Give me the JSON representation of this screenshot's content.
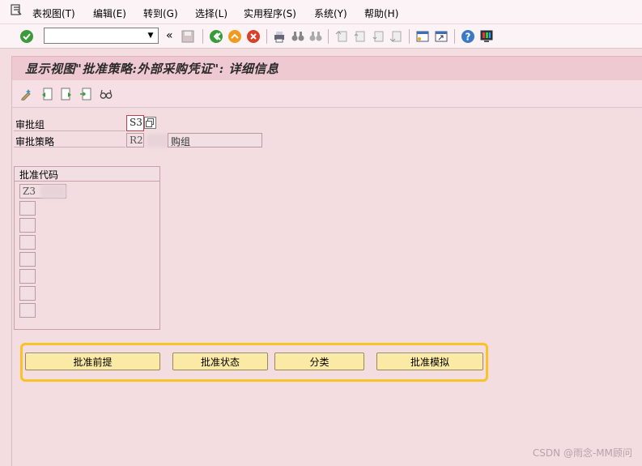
{
  "menubar": {
    "items": [
      {
        "label": "表视图(T)"
      },
      {
        "label": "编辑(E)"
      },
      {
        "label": "转到(G)"
      },
      {
        "label": "选择(L)"
      },
      {
        "label": "实用程序(S)"
      },
      {
        "label": "系统(Y)"
      },
      {
        "label": "帮助(H)"
      }
    ]
  },
  "toolbar": {
    "command_value": "",
    "back_glyph": "«"
  },
  "title": "显示视图\"批准策略:外部采购凭证\": 详细信息",
  "fields": {
    "release_group_label": "审批组",
    "release_group_value": "S3",
    "release_strategy_label": "审批策略",
    "release_strategy_value": "R2",
    "release_strategy_desc": "购组"
  },
  "release_codes": {
    "header": "批准代码",
    "rows": [
      "Z3",
      "",
      "",
      "",
      "",
      "",
      "",
      ""
    ]
  },
  "buttons": {
    "prerequisites": "批准前提",
    "status": "批准状态",
    "classification": "分类",
    "simulation": "批准模拟"
  },
  "watermark": "CSDN @雨念-MM顾问",
  "colors": {
    "title_bg": "#efc9d2",
    "button_bg": "#fbeaa6",
    "highlight_frame": "#f7c325"
  }
}
